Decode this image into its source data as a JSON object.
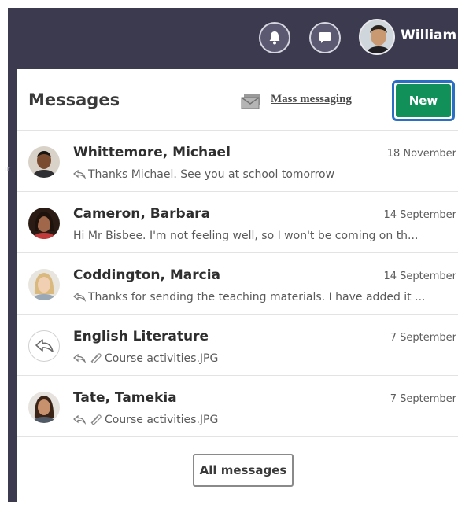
{
  "topbar": {
    "username": "William",
    "icons": [
      "bell-icon",
      "chat-bubble-icon"
    ]
  },
  "panel": {
    "title": "Messages",
    "mass_messaging_label": "Mass messaging",
    "new_button_label": "New",
    "all_messages_label": "All messages"
  },
  "messages": [
    {
      "name": "Whittemore, Michael",
      "date": "18 November",
      "snippet": "Thanks Michael. See you at school tomorrow",
      "reply_icon": true,
      "attachment_icon": false
    },
    {
      "name": "Cameron, Barbara",
      "date": "14 September",
      "snippet": "Hi Mr Bisbee. I'm not feeling well, so I won't be coming on th...",
      "reply_icon": false,
      "attachment_icon": false
    },
    {
      "name": "Coddington, Marcia",
      "date": "14 September",
      "snippet": "Thanks for sending the teaching materials. I have added it ...",
      "reply_icon": true,
      "attachment_icon": false
    },
    {
      "name": "English Literature",
      "date": "7 September",
      "snippet": "Course activities.JPG",
      "reply_icon": true,
      "attachment_icon": true
    },
    {
      "name": "Tate, Tamekia",
      "date": "7 September",
      "snippet": "Course activities.JPG",
      "reply_icon": true,
      "attachment_icon": true
    }
  ],
  "colors": {
    "backdrop": "#3b3a4f",
    "new_button": "#12905a",
    "new_button_focus_ring": "#2b6fc4"
  }
}
